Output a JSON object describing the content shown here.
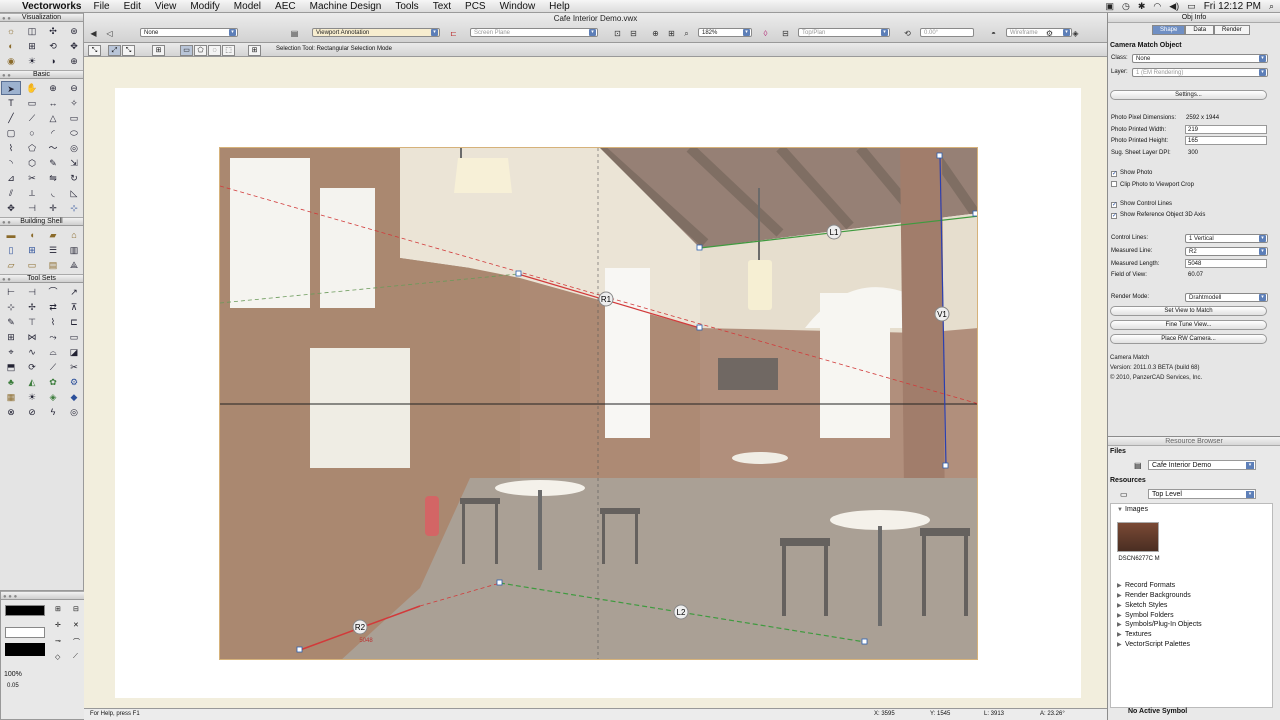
{
  "menubar": {
    "app": "Vectorworks",
    "items": [
      "File",
      "Edit",
      "View",
      "Modify",
      "Model",
      "AEC",
      "Machine Design",
      "Tools",
      "Text",
      "PCS",
      "Window",
      "Help"
    ],
    "clock": "Fri 12:12 PM"
  },
  "document": {
    "title": "Cafe Interior Demo.vwx"
  },
  "toolbar": {
    "class_dropdown": "None",
    "layer_dropdown": "Viewport Annotation",
    "plane_dropdown": "Screen Plane",
    "zoom": "182%",
    "view_dropdown": "Top/Plan",
    "rotation": "0.00°",
    "render_dropdown": "Wireframe"
  },
  "modebar": {
    "message": "Selection Tool: Rectangular Selection Mode"
  },
  "palettes": {
    "visualization": "Visualization",
    "basic": "Basic",
    "building_shell": "Building Shell",
    "tool_sets": "Tool Sets",
    "attributes": {
      "opacity": "100%",
      "line_weight": "0.05"
    }
  },
  "photo": {
    "labels": {
      "l1": "L1",
      "l2": "L2",
      "r1": "R1",
      "r2": "R2",
      "v1": "V1",
      "measure": "5048"
    }
  },
  "status": {
    "help": "For Help, press F1",
    "x": "X: 3595",
    "y": "Y: 1545",
    "l": "L: 3913",
    "angle": "A: 23.26°"
  },
  "objinfo": {
    "title": "Obj Info",
    "tabs": [
      "Shape",
      "Data",
      "Render"
    ],
    "object_type": "Camera Match Object",
    "class_label": "Class:",
    "class_value": "None",
    "layer_label": "Layer:",
    "layer_value": "1 (EM Rendering)",
    "settings_button": "Settings...",
    "rows": [
      {
        "label": "Photo Pixel Dimensions:",
        "value": "2592 x 1944"
      },
      {
        "label": "Photo Printed Width:",
        "value": "219"
      },
      {
        "label": "Photo Printed Height:",
        "value": "165"
      },
      {
        "label": "Sug. Sheet Layer DPI:",
        "value": "300"
      }
    ],
    "checks": [
      {
        "label": "Show Photo",
        "checked": true
      },
      {
        "label": "Clip Photo to Viewport Crop",
        "checked": false
      },
      {
        "label": "Show Control Lines",
        "checked": true
      },
      {
        "label": "Show Reference Object 3D Axis",
        "checked": true
      }
    ],
    "control_lines_label": "Control Lines:",
    "control_lines_value": "1 Vertical",
    "measured_line_label": "Measured Line:",
    "measured_line_value": "R2",
    "measured_length_label": "Measured Length:",
    "measured_length_value": "5048",
    "fov_label": "Field of View:",
    "fov_value": "60.07",
    "render_mode_label": "Render Mode:",
    "render_mode_value": "Drahtmodell",
    "buttons": [
      "Set View to Match",
      "Fine Tune View...",
      "Place RW Camera..."
    ],
    "about": [
      "Camera Match",
      "Version: 2011.0.3 BETA (build 68)",
      "© 2010, PanzerCAD Services, Inc."
    ]
  },
  "resource": {
    "title": "Resource Browser",
    "files_label": "Files",
    "files_value": "Cafe Interior Demo",
    "resources_label": "Resources",
    "resources_value": "Top Level",
    "images_group": "Images",
    "image_name": "DSCN6277C M",
    "groups": [
      "Record Formats",
      "Render Backgrounds",
      "Sketch Styles",
      "Symbol Folders",
      "Symbols/Plug-In Objects",
      "Textures",
      "VectorScript Palettes"
    ],
    "footer": "No Active Symbol"
  }
}
